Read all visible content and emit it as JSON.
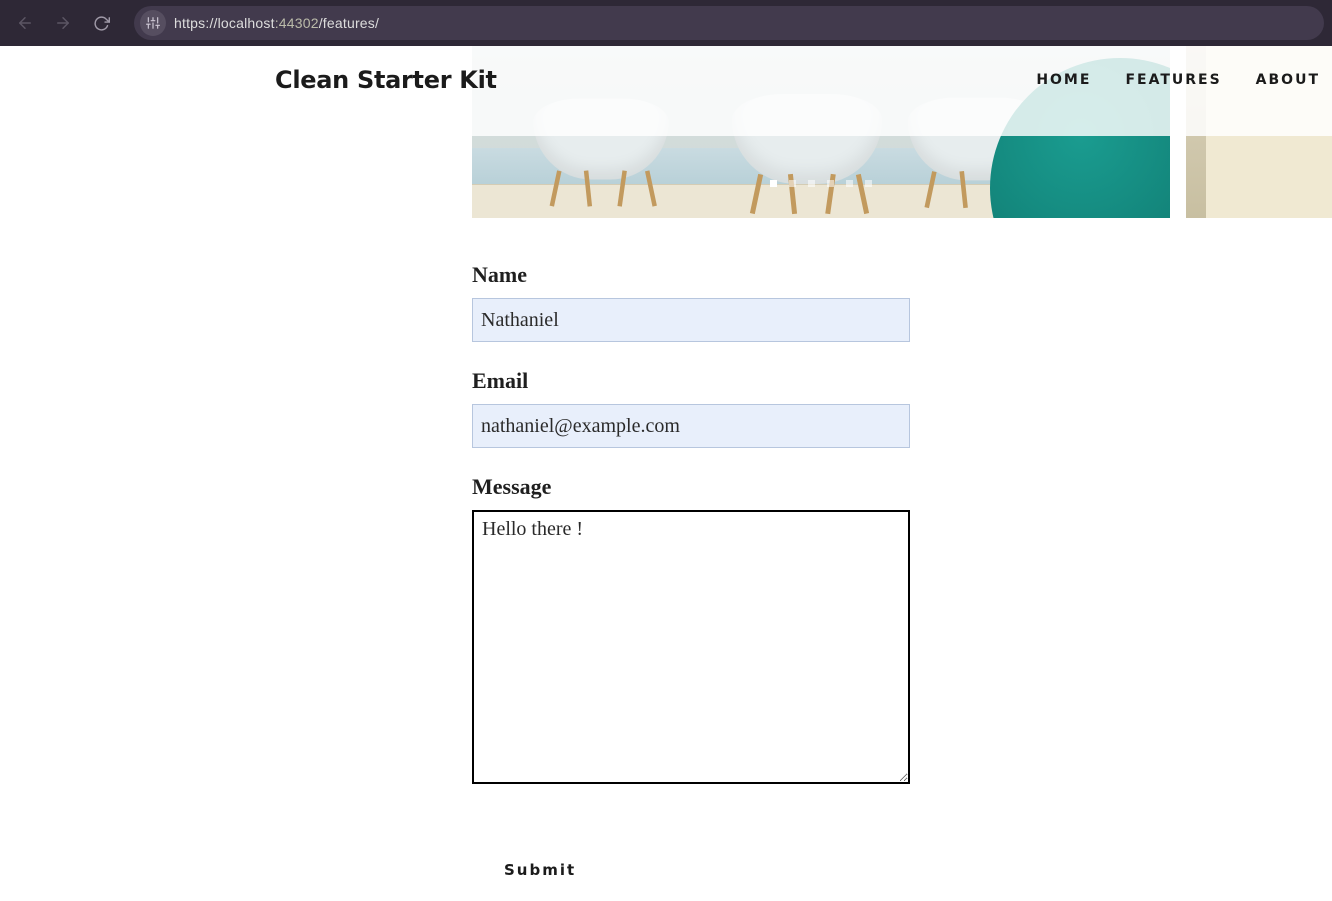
{
  "browser": {
    "url_prefix": "https://",
    "url_host": "localhost",
    "url_port": ":44302",
    "url_path": "/features/"
  },
  "header": {
    "brand": "Clean Starter Kit",
    "nav": {
      "home": "HOME",
      "features": "FEATURES",
      "about": "ABOUT"
    }
  },
  "carousel": {
    "slide_count": 6,
    "active_index": 0
  },
  "form": {
    "name_label": "Name",
    "name_value": "Nathaniel",
    "email_label": "Email",
    "email_value": "nathaniel@example.com",
    "message_label": "Message",
    "message_value": "Hello there !",
    "submit_label": "Submit"
  }
}
